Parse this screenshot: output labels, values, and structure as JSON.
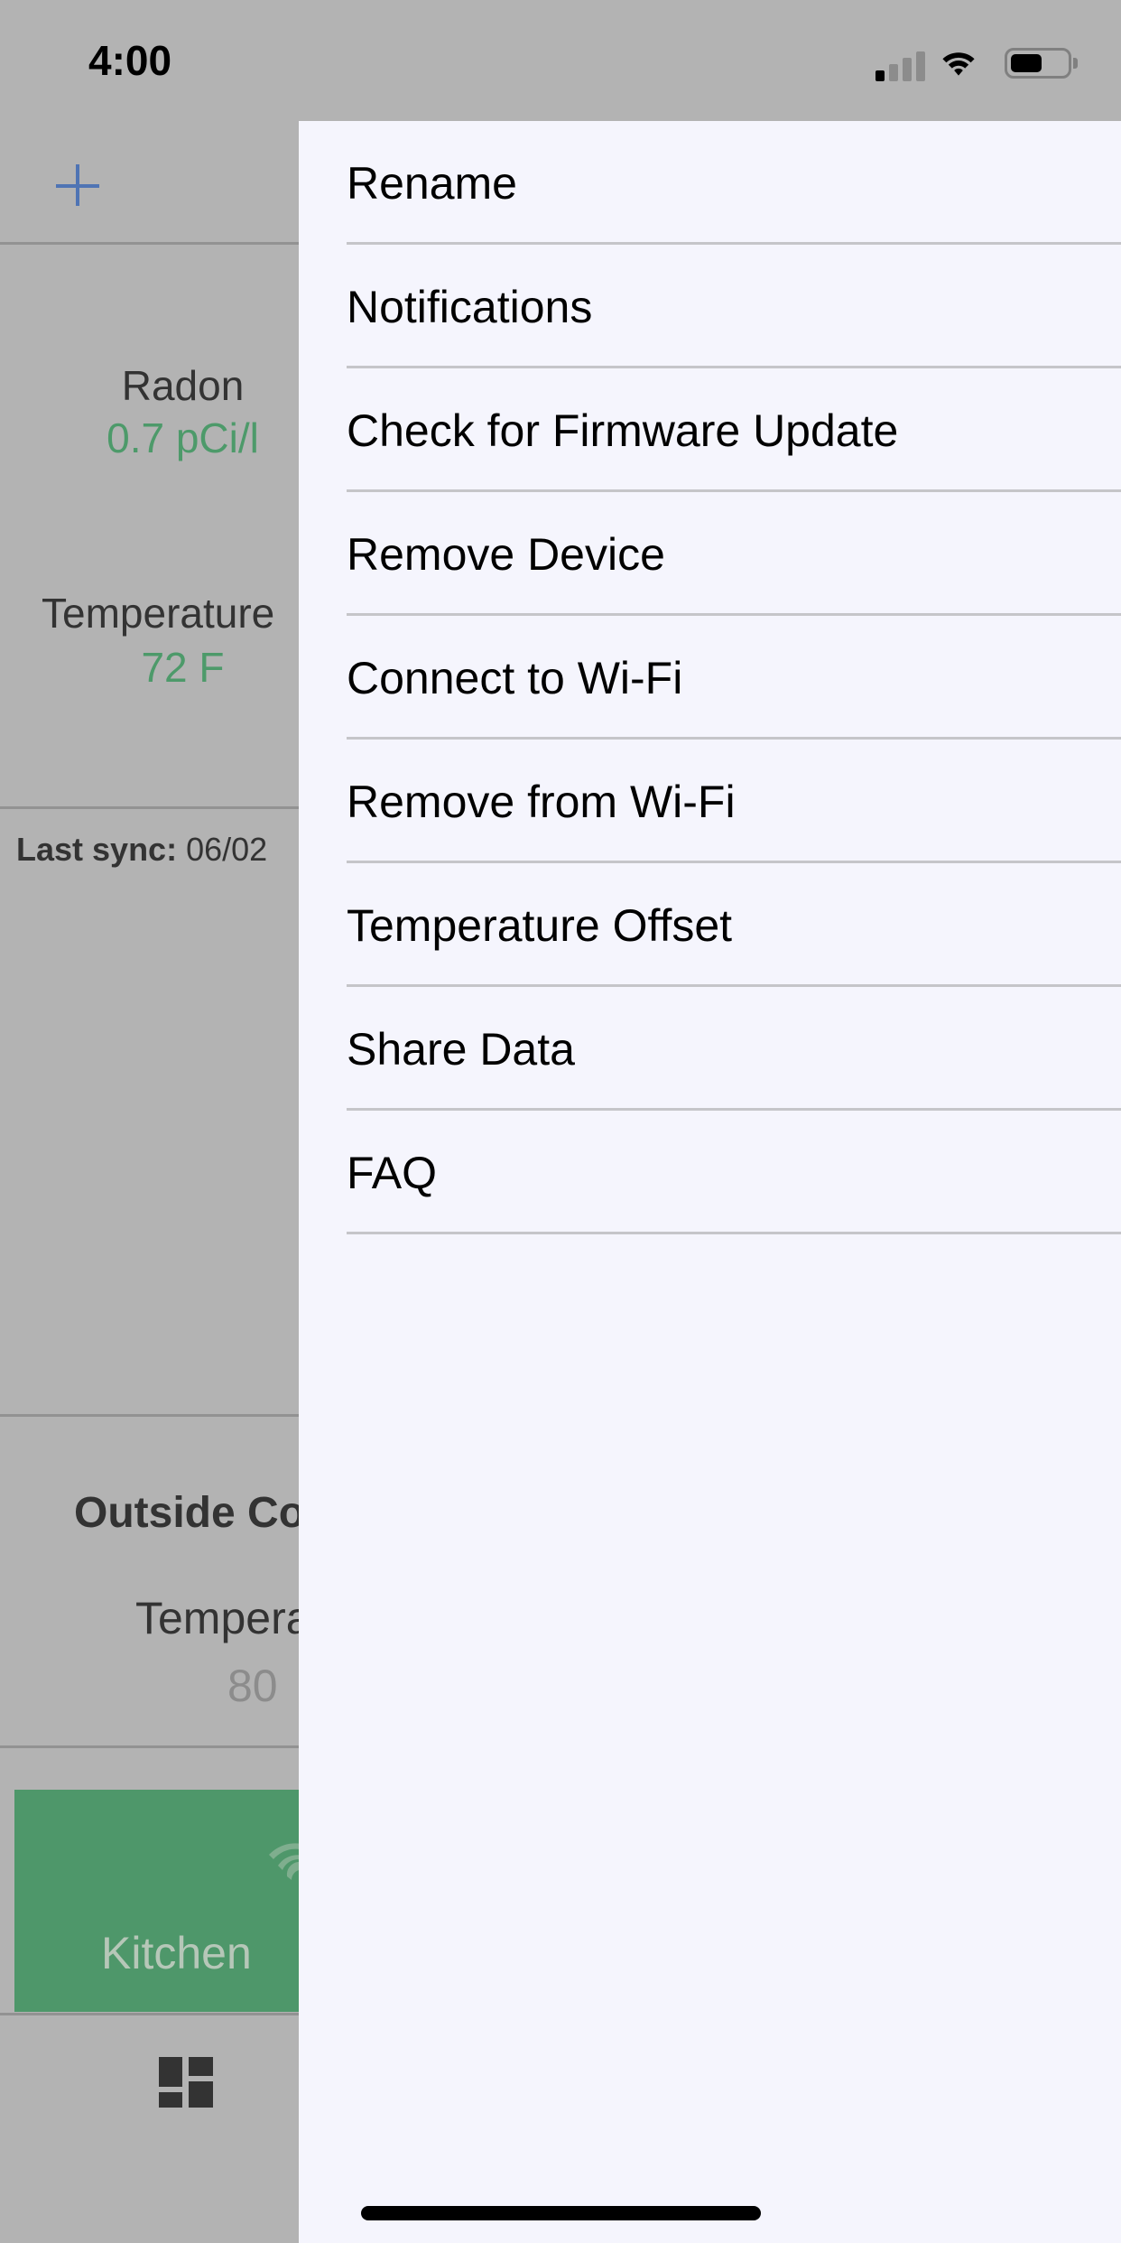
{
  "status_bar": {
    "time": "4:00",
    "signal_bars_active": 1,
    "signal_bars_total": 4,
    "battery_percent": 55,
    "icons": [
      "signal-icon",
      "wifi-icon",
      "battery-icon"
    ]
  },
  "background_screen": {
    "add_button_icon": "plus-icon",
    "metrics": [
      {
        "label": "Radon",
        "value": "0.7 pCi/l"
      },
      {
        "label": "Temperature",
        "value": "72 F"
      }
    ],
    "last_sync": {
      "label": "Last sync:",
      "value": "06/02"
    },
    "outside": {
      "title": "Outside Conditions",
      "temp_label": "Temperature",
      "temp_value": "80"
    },
    "device_tile": {
      "name": "Kitchen",
      "icon": "wifi-icon"
    },
    "tabbar": {
      "icon": "dashboard-icon"
    },
    "colors": {
      "accent_blue": "#4f74b4",
      "good_green": "#4d9a6a",
      "tile_green": "#4e976a"
    }
  },
  "drawer": {
    "menu_items": [
      {
        "label": "Rename"
      },
      {
        "label": "Notifications"
      },
      {
        "label": "Check for Firmware Update"
      },
      {
        "label": "Remove Device"
      },
      {
        "label": "Connect to Wi-Fi"
      },
      {
        "label": "Remove from Wi-Fi"
      },
      {
        "label": "Temperature Offset"
      },
      {
        "label": "Share Data"
      },
      {
        "label": "FAQ"
      }
    ]
  }
}
